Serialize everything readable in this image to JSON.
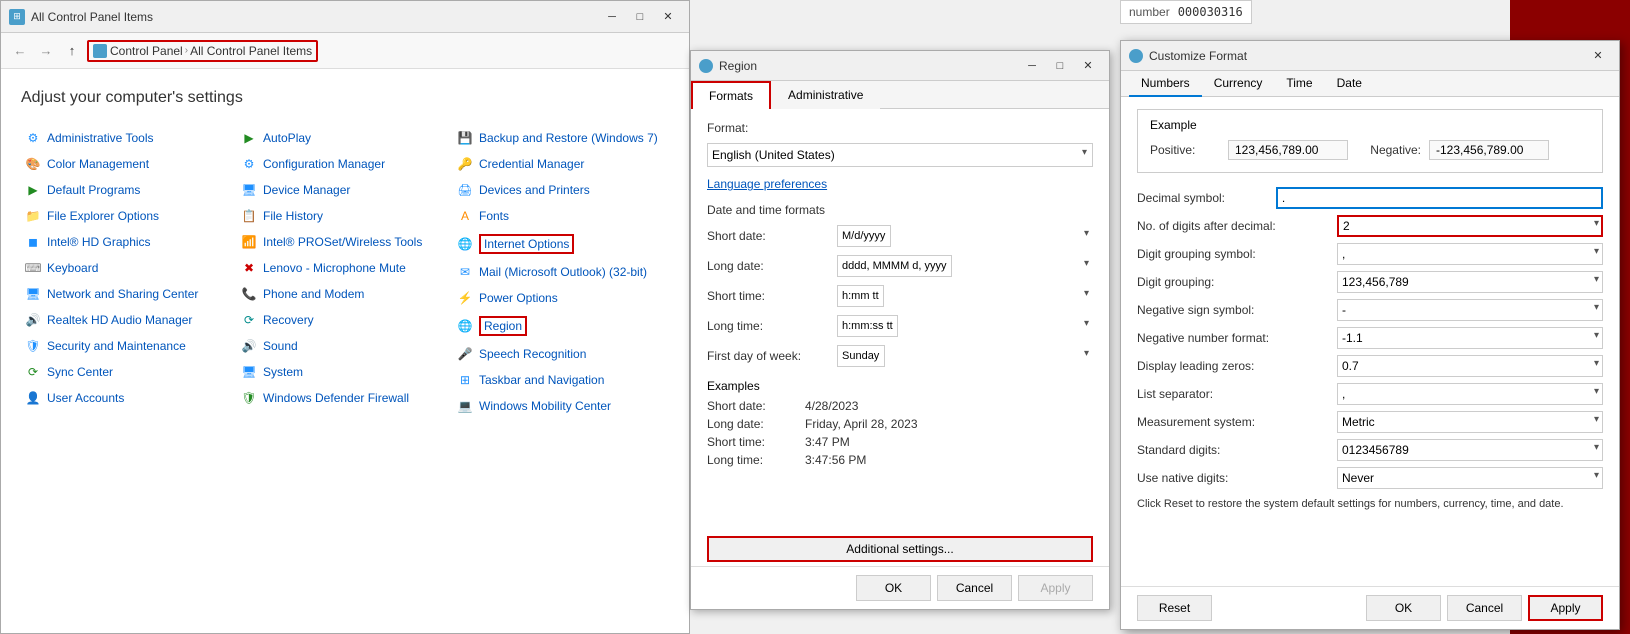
{
  "bg": {
    "color": "#8B0000"
  },
  "number_display": {
    "label": "number",
    "value": "000030316"
  },
  "control_panel": {
    "title": "All Control Panel Items",
    "titlebar_icon": "⚙",
    "breadcrumb": {
      "items": [
        "Control Panel",
        "All Control Panel Items"
      ]
    },
    "heading": "Adjust your computer's settings",
    "columns": [
      {
        "items": [
          {
            "label": "Administrative Tools",
            "icon": "⚙",
            "color": "icon-blue"
          },
          {
            "label": "Color Management",
            "icon": "🎨",
            "color": "icon-blue"
          },
          {
            "label": "Default Programs",
            "icon": "▶",
            "color": "icon-green"
          },
          {
            "label": "File Explorer Options",
            "icon": "📁",
            "color": "icon-yellow"
          },
          {
            "label": "Intel® HD Graphics",
            "icon": "◼",
            "color": "icon-blue"
          },
          {
            "label": "Keyboard",
            "icon": "⌨",
            "color": "icon-gray"
          },
          {
            "label": "Network and Sharing Center",
            "icon": "🖥",
            "color": "icon-blue"
          },
          {
            "label": "Realtek HD Audio Manager",
            "icon": "🔊",
            "color": "icon-orange"
          },
          {
            "label": "Security and Maintenance",
            "icon": "🛡",
            "color": "icon-blue"
          },
          {
            "label": "Sync Center",
            "icon": "⟳",
            "color": "icon-green"
          },
          {
            "label": "User Accounts",
            "icon": "👤",
            "color": "icon-blue"
          }
        ]
      },
      {
        "items": [
          {
            "label": "AutoPlay",
            "icon": "▶",
            "color": "icon-green"
          },
          {
            "label": "Configuration Manager",
            "icon": "⚙",
            "color": "icon-blue"
          },
          {
            "label": "Device Manager",
            "icon": "🖥",
            "color": "icon-blue"
          },
          {
            "label": "File History",
            "icon": "📋",
            "color": "icon-blue"
          },
          {
            "label": "Intel® PROSet/Wireless Tools",
            "icon": "📶",
            "color": "icon-blue"
          },
          {
            "label": "Lenovo - Microphone Mute",
            "icon": "✖",
            "color": "icon-red"
          },
          {
            "label": "Phone and Modem",
            "icon": "📞",
            "color": "icon-gray"
          },
          {
            "label": "Recovery",
            "icon": "⟳",
            "color": "icon-teal"
          },
          {
            "label": "Sound",
            "icon": "🔊",
            "color": "icon-gray"
          },
          {
            "label": "System",
            "icon": "🖥",
            "color": "icon-blue"
          },
          {
            "label": "Windows Defender Firewall",
            "icon": "🛡",
            "color": "icon-green"
          }
        ]
      },
      {
        "items": [
          {
            "label": "Backup and Restore (Windows 7)",
            "icon": "💾",
            "color": "icon-blue"
          },
          {
            "label": "Credential Manager",
            "icon": "🔑",
            "color": "icon-blue"
          },
          {
            "label": "Devices and Printers",
            "icon": "🖨",
            "color": "icon-blue"
          },
          {
            "label": "Fonts",
            "icon": "A",
            "color": "icon-orange"
          },
          {
            "label": "Internet Options",
            "icon": "🌐",
            "color": "icon-blue"
          },
          {
            "label": "Mail (Microsoft Outlook) (32-bit)",
            "icon": "✉",
            "color": "icon-blue"
          },
          {
            "label": "Power Options",
            "icon": "⚡",
            "color": "icon-blue"
          },
          {
            "label": "Region",
            "icon": "🌐",
            "color": "icon-blue"
          },
          {
            "label": "Speech Recognition",
            "icon": "🎤",
            "color": "icon-blue"
          },
          {
            "label": "Taskbar and Navigation",
            "icon": "⊞",
            "color": "icon-blue"
          },
          {
            "label": "Windows Mobility Center",
            "icon": "💻",
            "color": "icon-blue"
          }
        ]
      }
    ]
  },
  "region_window": {
    "title": "Region",
    "tabs": [
      "Formats",
      "Administrative"
    ],
    "active_tab": "Formats",
    "format_label": "Format:",
    "format_value": "English (United States)",
    "language_link": "Language preferences",
    "date_time_label": "Date and time formats",
    "fields": [
      {
        "label": "Short date:",
        "value": "M/d/yyyy"
      },
      {
        "label": "Long date:",
        "value": "dddd, MMMM d, yyyy"
      },
      {
        "label": "Short time:",
        "value": "h:mm tt"
      },
      {
        "label": "Long time:",
        "value": "h:mm:ss tt"
      },
      {
        "label": "First day of week:",
        "value": "Sunday"
      }
    ],
    "examples_title": "Examples",
    "examples": [
      {
        "label": "Short date:",
        "value": "4/28/2023"
      },
      {
        "label": "Long date:",
        "value": "Friday, April 28, 2023"
      },
      {
        "label": "Short time:",
        "value": "3:47 PM"
      },
      {
        "label": "Long time:",
        "value": "3:47:56 PM"
      }
    ],
    "additional_btn": "Additional settings...",
    "ok_btn": "OK",
    "cancel_btn": "Cancel",
    "apply_btn": "Apply"
  },
  "customize_window": {
    "title": "Customize Format",
    "tabs": [
      "Numbers",
      "Currency",
      "Time",
      "Date"
    ],
    "active_tab": "Numbers",
    "example_section": {
      "title": "Example",
      "positive_label": "Positive:",
      "positive_value": "123,456,789.00",
      "negative_label": "Negative:",
      "negative_value": "-123,456,789.00"
    },
    "fields": [
      {
        "label": "Decimal symbol:",
        "value": ".",
        "type": "input",
        "highlighted": false
      },
      {
        "label": "No. of digits after decimal:",
        "value": "2",
        "type": "select",
        "highlighted": true
      },
      {
        "label": "Digit grouping symbol:",
        "value": ",",
        "type": "select",
        "highlighted": false
      },
      {
        "label": "Digit grouping:",
        "value": "123,456,789",
        "type": "select",
        "highlighted": false
      },
      {
        "label": "Negative sign symbol:",
        "value": "-",
        "type": "select",
        "highlighted": false
      },
      {
        "label": "Negative number format:",
        "value": "-1.1",
        "type": "select",
        "highlighted": false
      },
      {
        "label": "Display leading zeros:",
        "value": "0.7",
        "type": "select",
        "highlighted": false
      },
      {
        "label": "List separator:",
        "value": ",",
        "type": "select",
        "highlighted": false
      },
      {
        "label": "Measurement system:",
        "value": "Metric",
        "type": "select",
        "highlighted": false
      },
      {
        "label": "Standard digits:",
        "value": "0123456789",
        "type": "select",
        "highlighted": false
      },
      {
        "label": "Use native digits:",
        "value": "Never",
        "type": "select",
        "highlighted": false
      }
    ],
    "reset_note": "Click Reset to restore the system default settings for numbers, currency, time, and date.",
    "reset_btn": "Reset",
    "ok_btn": "OK",
    "cancel_btn": "Cancel",
    "apply_btn": "Apply"
  }
}
